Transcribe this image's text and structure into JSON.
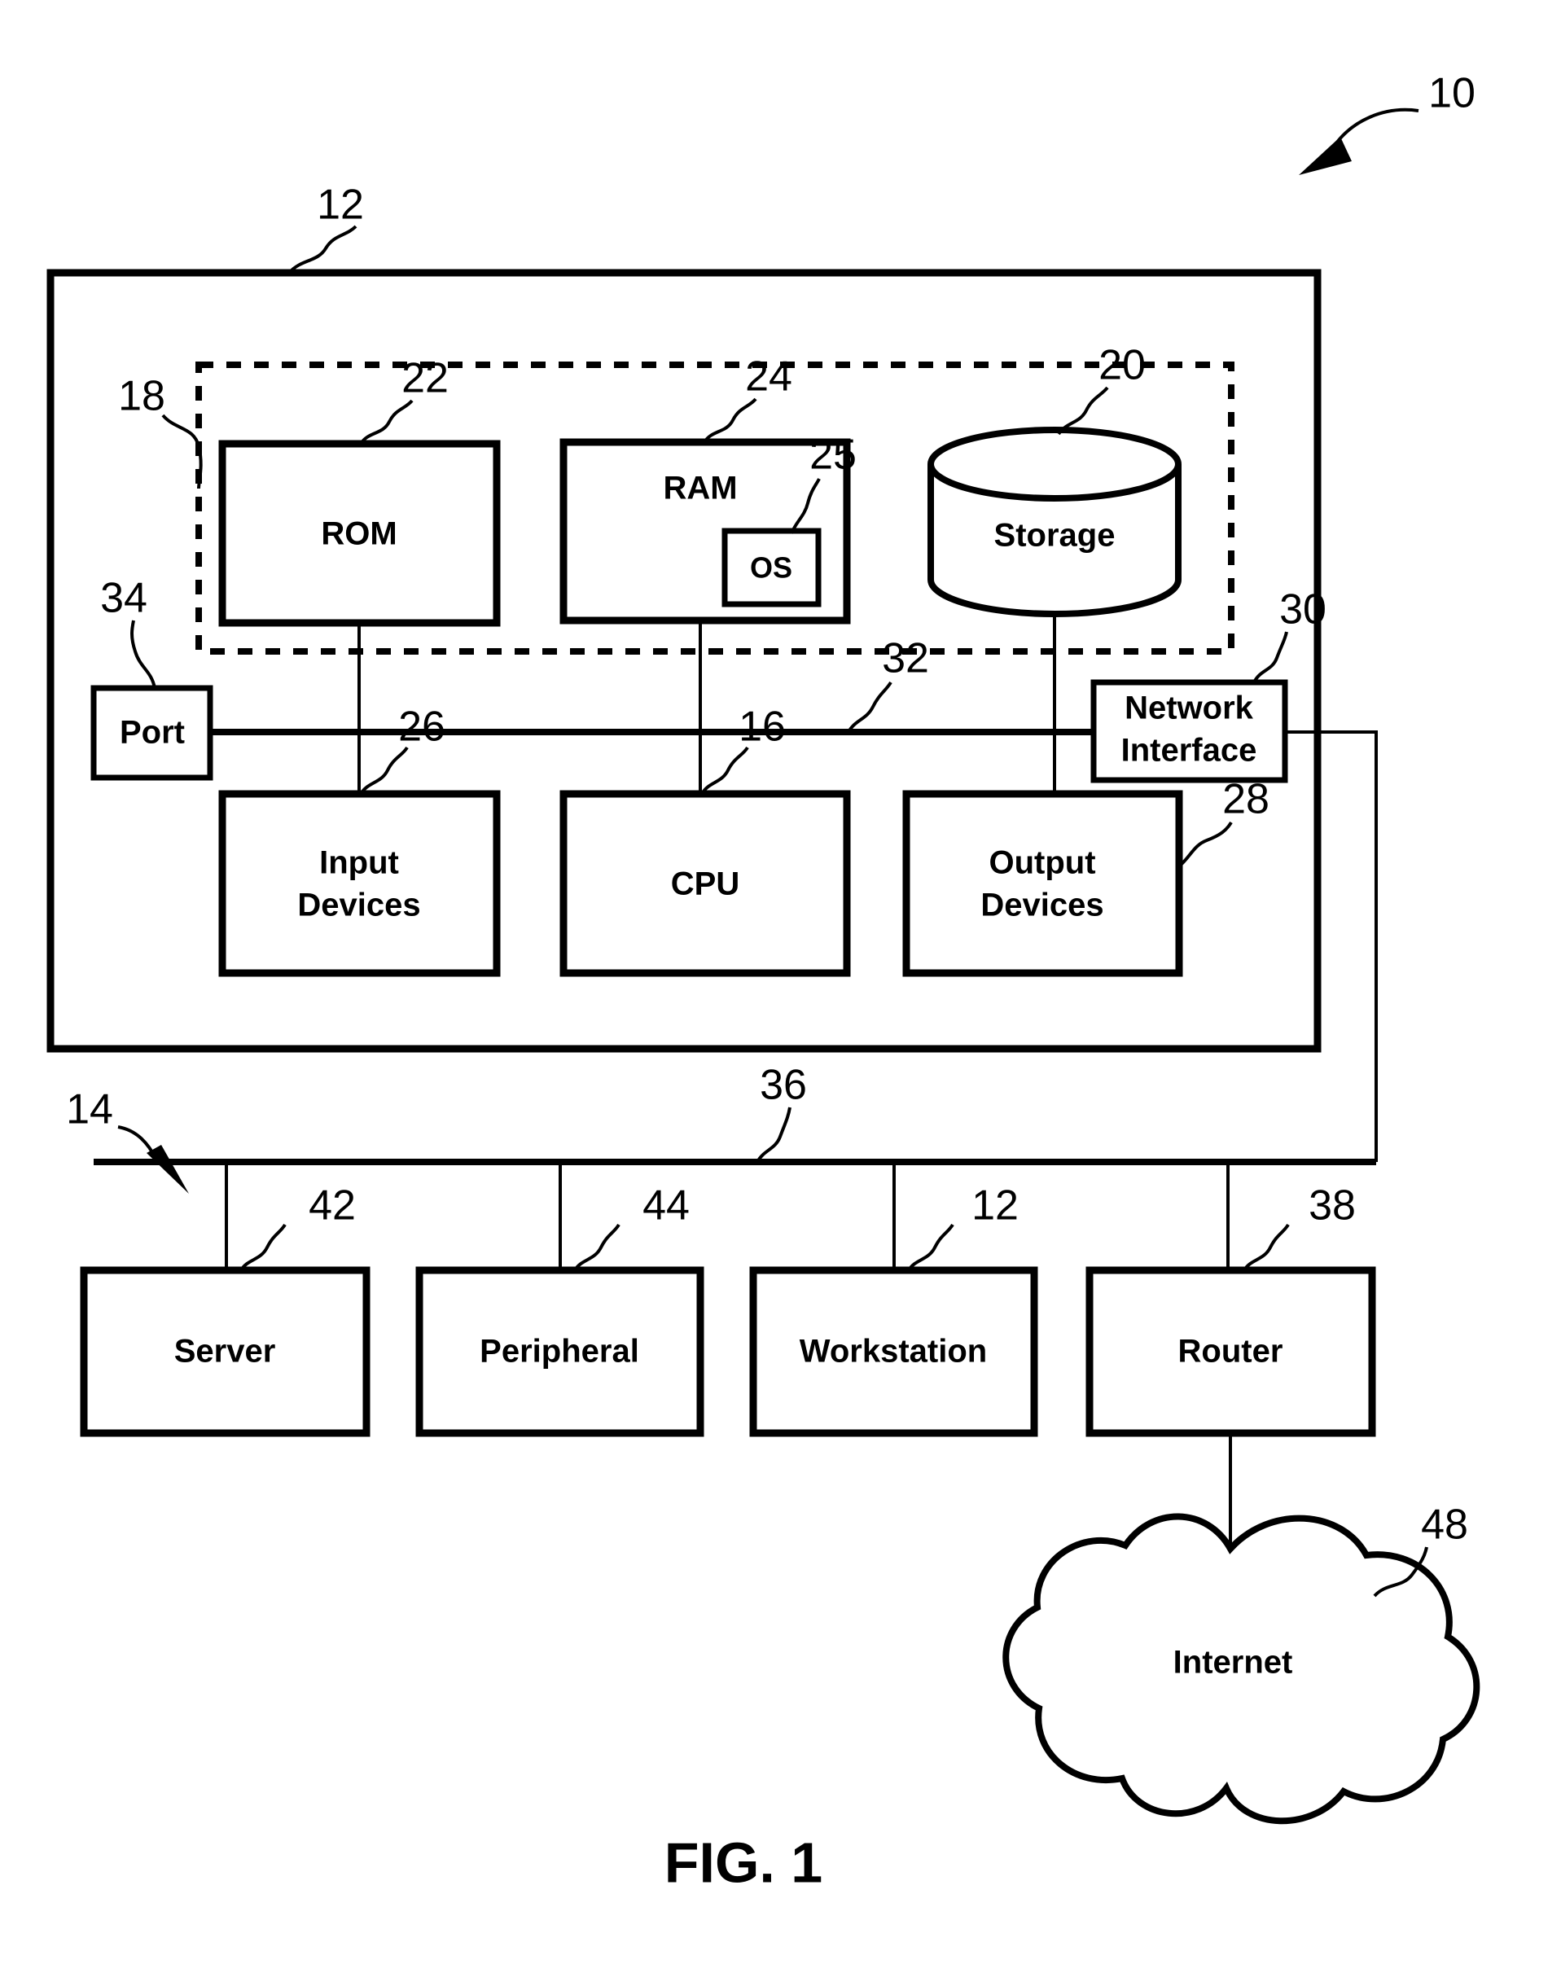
{
  "figure": {
    "caption": "FIG. 1",
    "system_ref": "10"
  },
  "computer": {
    "ref": "12",
    "memory_group": {
      "ref": "18",
      "blocks": [
        {
          "label": "ROM",
          "ref": "22"
        },
        {
          "label": "RAM",
          "ref": "24"
        },
        {
          "label": "OS",
          "ref": "25"
        },
        {
          "label": "Storage",
          "ref": "20"
        }
      ]
    },
    "bus": {
      "label": "",
      "ref": "32"
    },
    "port": {
      "label": "Port",
      "ref": "34"
    },
    "network_interface": {
      "label": "Network Interface",
      "line1": "Network",
      "line2": "Interface",
      "ref": "30"
    },
    "devices": [
      {
        "label": "Input Devices",
        "line1": "Input",
        "line2": "Devices",
        "ref": "26"
      },
      {
        "label": "CPU",
        "line1": "CPU",
        "line2": "",
        "ref": "16"
      },
      {
        "label": "Output Devices",
        "line1": "Output",
        "line2": "Devices",
        "ref": "28"
      }
    ]
  },
  "network": {
    "ref": "14",
    "bus_ref": "36",
    "nodes": [
      {
        "label": "Server",
        "ref": "42"
      },
      {
        "label": "Peripheral",
        "ref": "44"
      },
      {
        "label": "Workstation",
        "ref": "12"
      },
      {
        "label": "Router",
        "ref": "38"
      }
    ],
    "internet": {
      "label": "Internet",
      "ref": "48"
    }
  },
  "colors": {
    "stroke": "#000000",
    "background": "#ffffff"
  }
}
